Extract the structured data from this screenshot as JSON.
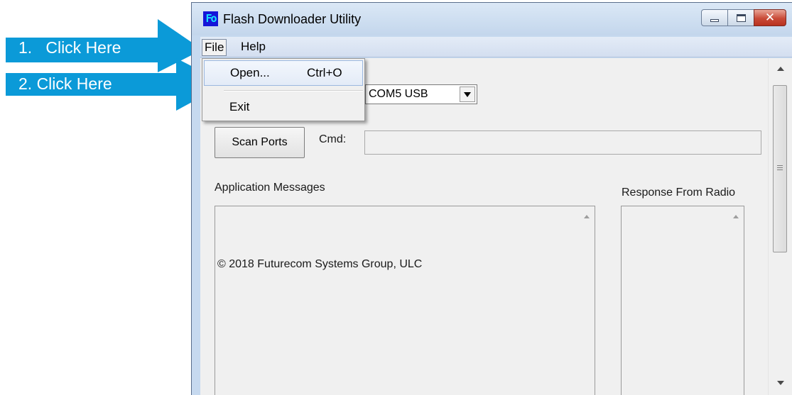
{
  "annotations": {
    "step1": "1.   Click Here",
    "step2": "2. Click Here",
    "color": "#0b9ad8"
  },
  "window": {
    "app_icon": "Fo",
    "title": "Flash Downloader Utility",
    "caption_buttons": [
      "minimize",
      "maximize",
      "close"
    ]
  },
  "menubar": {
    "file": "File",
    "help": "Help"
  },
  "file_menu": {
    "open_label": "Open...",
    "open_shortcut": "Ctrl+O",
    "exit_label": "Exit"
  },
  "main": {
    "port_select_value": "COM5 USB",
    "scan_ports_label": "Scan Ports",
    "cmd_label": "Cmd:",
    "cmd_value": "",
    "messages_label": "Application Messages",
    "messages_text": "© 2018 Futurecom Systems Group, ULC",
    "response_label": "Response From Radio"
  }
}
